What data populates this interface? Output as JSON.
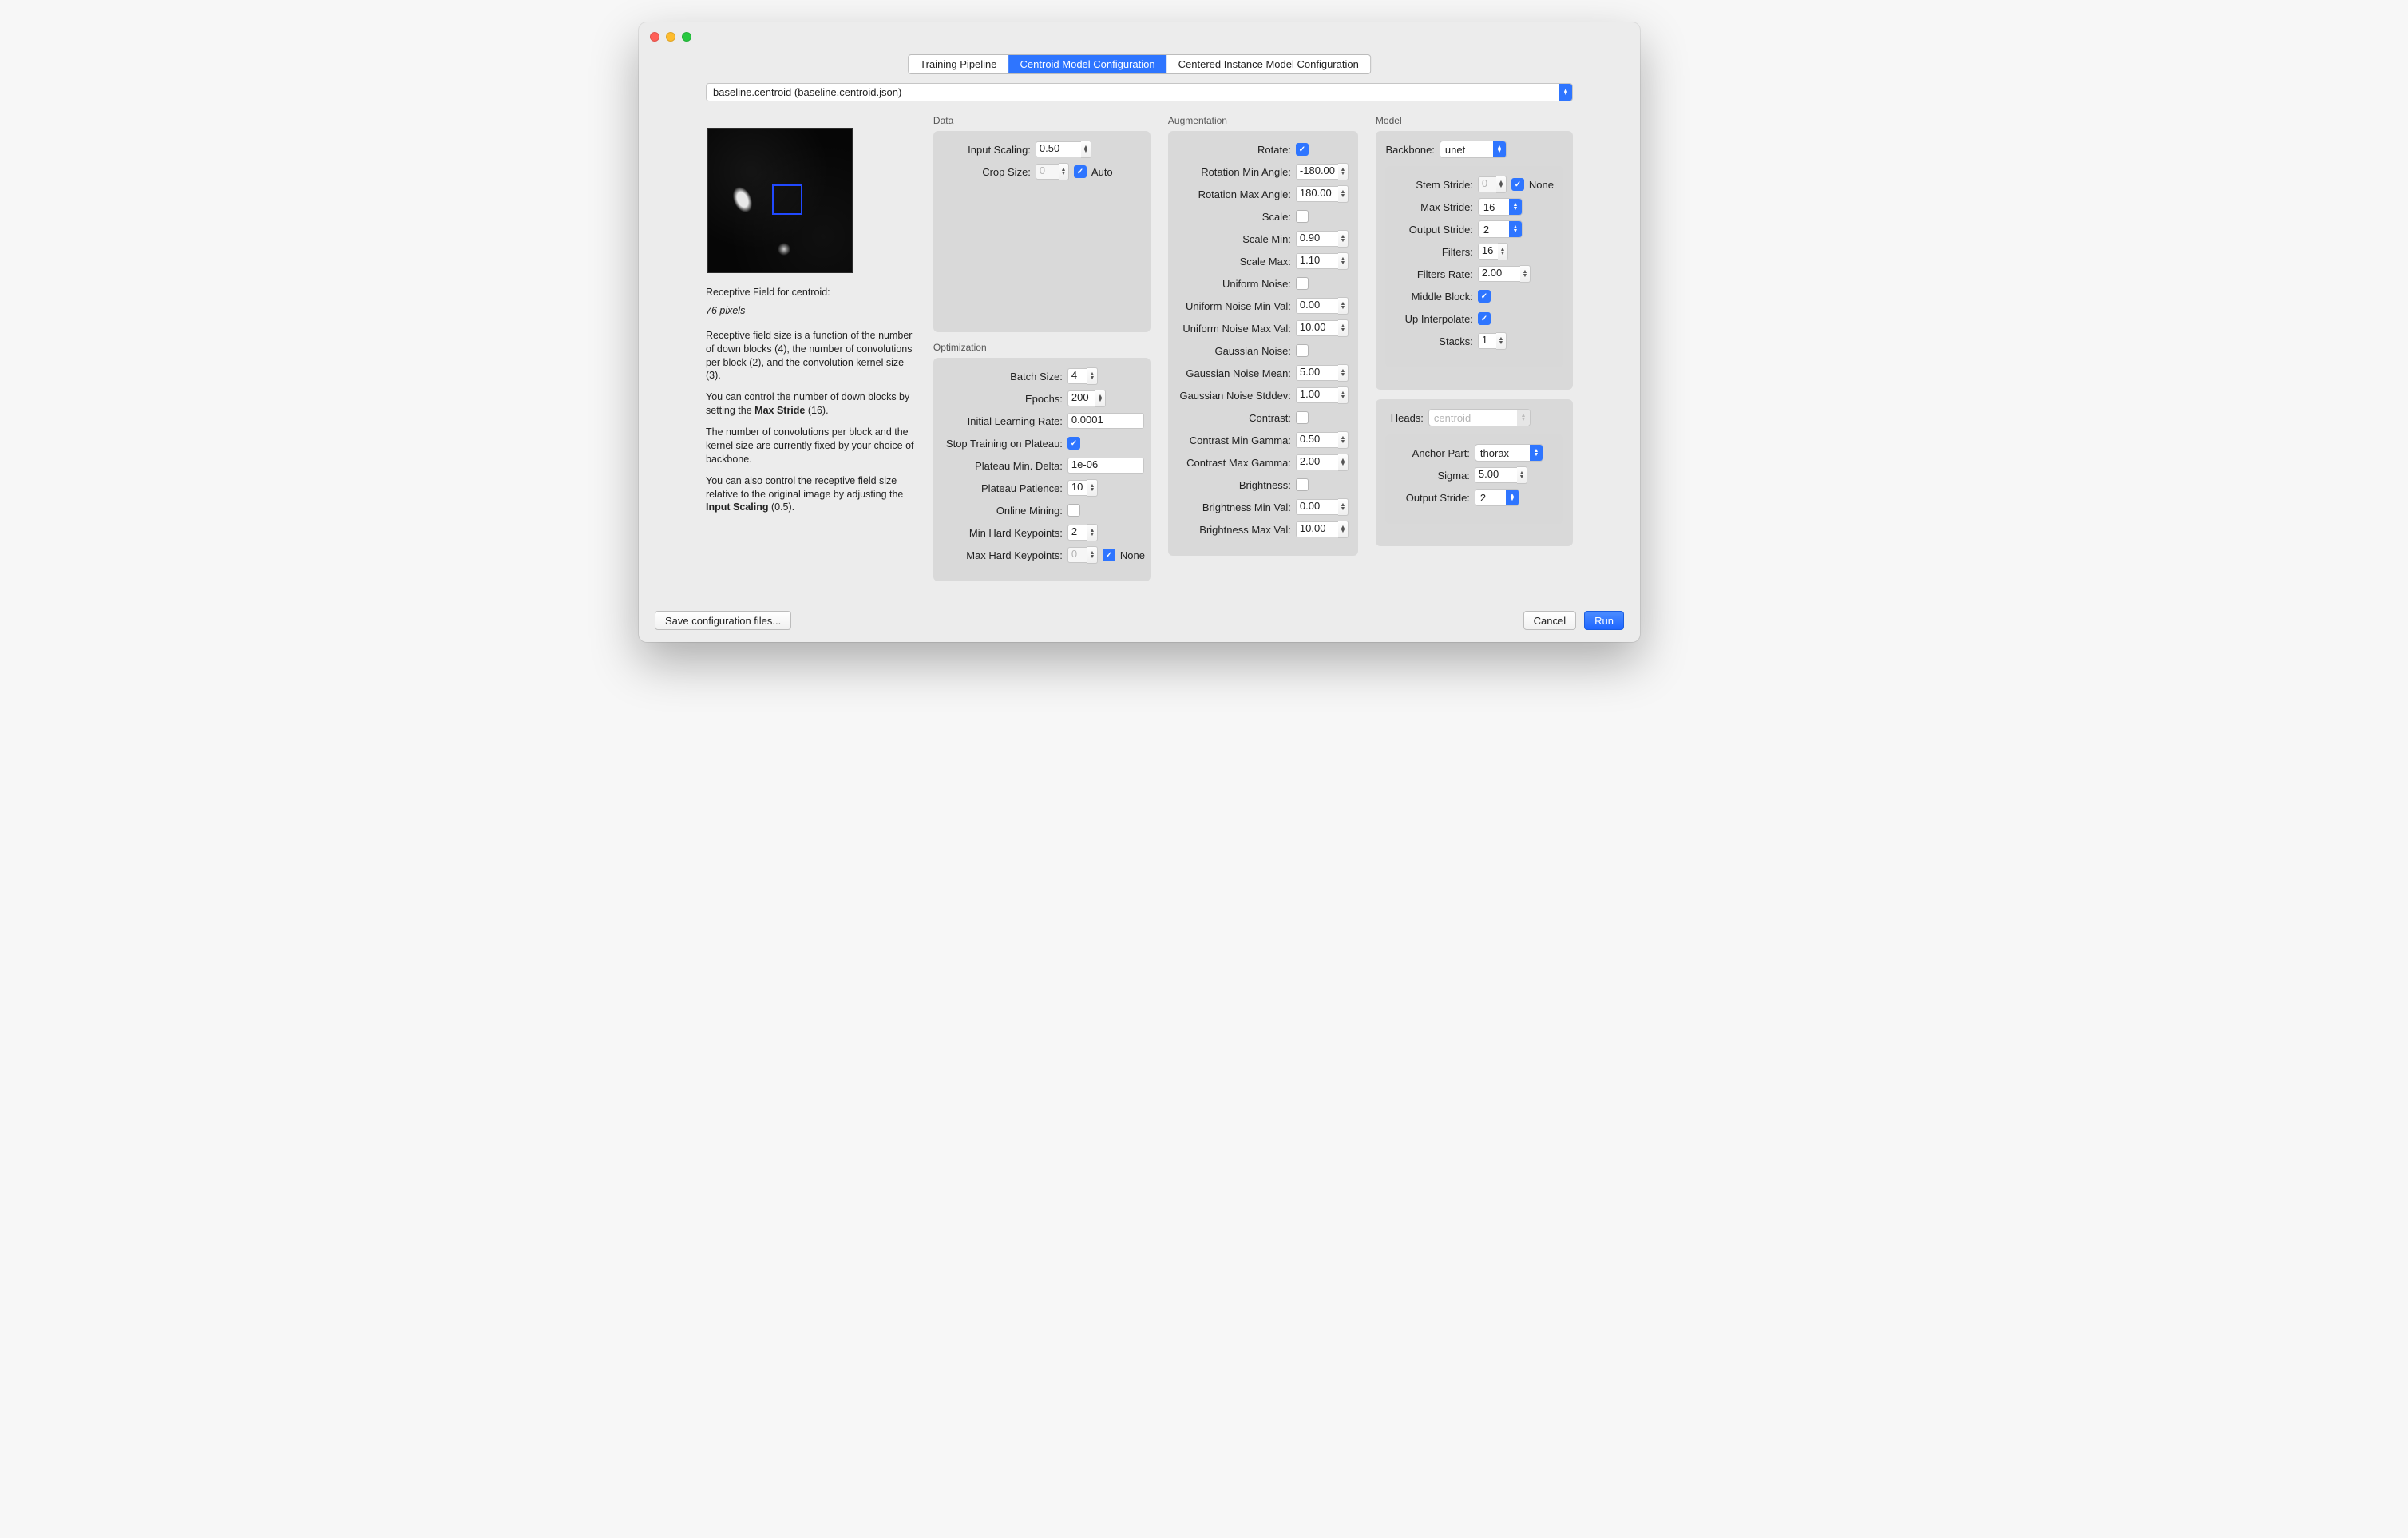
{
  "tabs": {
    "training": "Training Pipeline",
    "centroid": "Centroid Model Configuration",
    "instance": "Centered Instance Model Configuration"
  },
  "config_select": "baseline.centroid (baseline.centroid.json)",
  "info": {
    "title": "Receptive Field for centroid:",
    "rf": "76 pixels",
    "p1": "Receptive field size is a function of the number of down blocks (4), the number of convolutions per block (2), and the convolution kernel size (3).",
    "p2a": "You can control the number of down blocks by setting the ",
    "p2b_bold": "Max Stride",
    "p2c": " (16).",
    "p3": "The number of convolutions per block and the kernel size are currently fixed by your choice of backbone.",
    "p4a": "You can also control the receptive field size relative to the original image by adjusting the ",
    "p4b_bold": "Input Scaling",
    "p4c": " (0.5)."
  },
  "sections": {
    "data": "Data",
    "optimization": "Optimization",
    "augmentation": "Augmentation",
    "model": "Model"
  },
  "data": {
    "input_scaling_label": "Input Scaling:",
    "input_scaling": "0.50",
    "crop_size_label": "Crop Size:",
    "crop_size": "0",
    "crop_auto_label": "Auto"
  },
  "opt": {
    "batch_label": "Batch Size:",
    "batch": "4",
    "epochs_label": "Epochs:",
    "epochs": "200",
    "lr_label": "Initial Learning Rate:",
    "lr": "0.0001",
    "plateau_stop_label": "Stop Training on Plateau:",
    "plateau_delta_label": "Plateau Min. Delta:",
    "plateau_delta": "1e-06",
    "plateau_patience_label": "Plateau Patience:",
    "plateau_patience": "10",
    "online_mining_label": "Online Mining:",
    "min_hard_label": "Min Hard Keypoints:",
    "min_hard": "2",
    "max_hard_label": "Max Hard Keypoints:",
    "max_hard": "0",
    "none_label": "None"
  },
  "aug": {
    "rotate_label": "Rotate:",
    "rot_min_label": "Rotation Min Angle:",
    "rot_min": "-180.00",
    "rot_max_label": "Rotation Max Angle:",
    "rot_max": "180.00",
    "scale_label": "Scale:",
    "scale_min_label": "Scale Min:",
    "scale_min": "0.90",
    "scale_max_label": "Scale Max:",
    "scale_max": "1.10",
    "unoise_label": "Uniform Noise:",
    "unoise_min_label": "Uniform Noise Min Val:",
    "unoise_min": "0.00",
    "unoise_max_label": "Uniform Noise Max Val:",
    "unoise_max": "10.00",
    "gnoise_label": "Gaussian Noise:",
    "gnoise_mean_label": "Gaussian Noise Mean:",
    "gnoise_mean": "5.00",
    "gnoise_std_label": "Gaussian Noise Stddev:",
    "gnoise_std": "1.00",
    "contrast_label": "Contrast:",
    "contrast_min_label": "Contrast Min Gamma:",
    "contrast_min": "0.50",
    "contrast_max_label": "Contrast Max Gamma:",
    "contrast_max": "2.00",
    "bright_label": "Brightness:",
    "bright_min_label": "Brightness Min Val:",
    "bright_min": "0.00",
    "bright_max_label": "Brightness Max Val:",
    "bright_max": "10.00"
  },
  "model": {
    "backbone_label": "Backbone:",
    "backbone": "unet",
    "stem_label": "Stem Stride:",
    "stem": "0",
    "stem_none_label": "None",
    "max_stride_label": "Max Stride:",
    "max_stride": "16",
    "out_stride_label": "Output Stride:",
    "out_stride": "2",
    "filters_label": "Filters:",
    "filters": "16",
    "filters_rate_label": "Filters Rate:",
    "filters_rate": "2.00",
    "middle_label": "Middle Block:",
    "upinterp_label": "Up Interpolate:",
    "stacks_label": "Stacks:",
    "stacks": "1"
  },
  "heads": {
    "label": "Heads:",
    "value": "centroid",
    "anchor_label": "Anchor Part:",
    "anchor": "thorax",
    "sigma_label": "Sigma:",
    "sigma": "5.00",
    "out_stride_label": "Output Stride:",
    "out_stride": "2"
  },
  "footer": {
    "save": "Save configuration files...",
    "cancel": "Cancel",
    "run": "Run"
  }
}
